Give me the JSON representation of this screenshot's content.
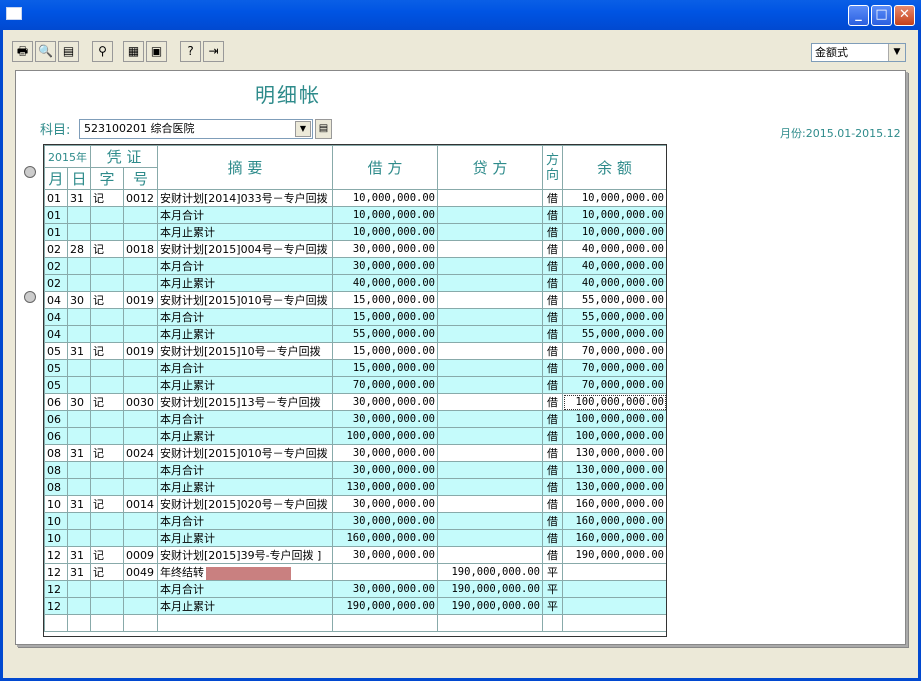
{
  "window": {
    "minimize": "_",
    "maximize": "□",
    "close": "✕"
  },
  "toolbar": {
    "buttons": [
      {
        "name": "print-icon",
        "glyph": "🖶"
      },
      {
        "name": "print-preview-icon",
        "glyph": "🔍"
      },
      {
        "name": "export-icon",
        "glyph": "▤"
      },
      {
        "name": "find-icon",
        "glyph": "⚲"
      },
      {
        "name": "grid-icon",
        "glyph": "▦"
      },
      {
        "name": "calculator-icon",
        "glyph": "▣"
      },
      {
        "name": "help-icon",
        "glyph": "?"
      },
      {
        "name": "exit-icon",
        "glyph": "⇥"
      }
    ],
    "format_select": "金额式"
  },
  "page": {
    "title": "明细帐",
    "subject_label": "科目:",
    "subject_value": "523100201   综合医院",
    "period": "月份:2015.01-2015.12"
  },
  "table": {
    "headers": {
      "year": "2015年",
      "voucher": "凭 证",
      "summary": "摘  要",
      "debit": "借  方",
      "credit": "贷  方",
      "direction": "方向",
      "balance": "余  额",
      "month": "月",
      "day": "日",
      "word": "字",
      "number": "号"
    },
    "rows": [
      {
        "m": "01",
        "d": "31",
        "w": "记",
        "n": "0012",
        "s": "安财计划[2014]033号－专户回拨",
        "debit": "10,000,000.00",
        "credit": "",
        "dir": "借",
        "bal": "10,000,000.00",
        "style": "white"
      },
      {
        "m": "01",
        "d": "",
        "w": "",
        "n": "",
        "s": "本月合计",
        "debit": "10,000,000.00",
        "credit": "",
        "dir": "借",
        "bal": "10,000,000.00",
        "style": "cyan"
      },
      {
        "m": "01",
        "d": "",
        "w": "",
        "n": "",
        "s": "本月止累计",
        "debit": "10,000,000.00",
        "credit": "",
        "dir": "借",
        "bal": "10,000,000.00",
        "style": "cyan"
      },
      {
        "m": "02",
        "d": "28",
        "w": "记",
        "n": "0018",
        "s": "安财计划[2015]004号－专户回拨",
        "debit": "30,000,000.00",
        "credit": "",
        "dir": "借",
        "bal": "40,000,000.00",
        "style": "white"
      },
      {
        "m": "02",
        "d": "",
        "w": "",
        "n": "",
        "s": "本月合计",
        "debit": "30,000,000.00",
        "credit": "",
        "dir": "借",
        "bal": "40,000,000.00",
        "style": "cyan"
      },
      {
        "m": "02",
        "d": "",
        "w": "",
        "n": "",
        "s": "本月止累计",
        "debit": "40,000,000.00",
        "credit": "",
        "dir": "借",
        "bal": "40,000,000.00",
        "style": "cyan"
      },
      {
        "m": "04",
        "d": "30",
        "w": "记",
        "n": "0019",
        "s": "安财计划[2015]010号－专户回拨",
        "debit": "15,000,000.00",
        "credit": "",
        "dir": "借",
        "bal": "55,000,000.00",
        "style": "white"
      },
      {
        "m": "04",
        "d": "",
        "w": "",
        "n": "",
        "s": "本月合计",
        "debit": "15,000,000.00",
        "credit": "",
        "dir": "借",
        "bal": "55,000,000.00",
        "style": "cyan"
      },
      {
        "m": "04",
        "d": "",
        "w": "",
        "n": "",
        "s": "本月止累计",
        "debit": "55,000,000.00",
        "credit": "",
        "dir": "借",
        "bal": "55,000,000.00",
        "style": "cyan"
      },
      {
        "m": "05",
        "d": "31",
        "w": "记",
        "n": "0019",
        "s": "安财计划[2015]10号－专户回拨",
        "debit": "15,000,000.00",
        "credit": "",
        "dir": "借",
        "bal": "70,000,000.00",
        "style": "white"
      },
      {
        "m": "05",
        "d": "",
        "w": "",
        "n": "",
        "s": "本月合计",
        "debit": "15,000,000.00",
        "credit": "",
        "dir": "借",
        "bal": "70,000,000.00",
        "style": "cyan"
      },
      {
        "m": "05",
        "d": "",
        "w": "",
        "n": "",
        "s": "本月止累计",
        "debit": "70,000,000.00",
        "credit": "",
        "dir": "借",
        "bal": "70,000,000.00",
        "style": "cyan"
      },
      {
        "m": "06",
        "d": "30",
        "w": "记",
        "n": "0030",
        "s": "安财计划[2015]13号－专户回拨",
        "debit": "30,000,000.00",
        "credit": "",
        "dir": "借",
        "bal": "100,000,000.00",
        "style": "white",
        "sel": true
      },
      {
        "m": "06",
        "d": "",
        "w": "",
        "n": "",
        "s": "本月合计",
        "debit": "30,000,000.00",
        "credit": "",
        "dir": "借",
        "bal": "100,000,000.00",
        "style": "cyan"
      },
      {
        "m": "06",
        "d": "",
        "w": "",
        "n": "",
        "s": "本月止累计",
        "debit": "100,000,000.00",
        "credit": "",
        "dir": "借",
        "bal": "100,000,000.00",
        "style": "cyan"
      },
      {
        "m": "08",
        "d": "31",
        "w": "记",
        "n": "0024",
        "s": "安财计划[2015]010号－专户回拨",
        "debit": "30,000,000.00",
        "credit": "",
        "dir": "借",
        "bal": "130,000,000.00",
        "style": "white"
      },
      {
        "m": "08",
        "d": "",
        "w": "",
        "n": "",
        "s": "本月合计",
        "debit": "30,000,000.00",
        "credit": "",
        "dir": "借",
        "bal": "130,000,000.00",
        "style": "cyan"
      },
      {
        "m": "08",
        "d": "",
        "w": "",
        "n": "",
        "s": "本月止累计",
        "debit": "130,000,000.00",
        "credit": "",
        "dir": "借",
        "bal": "130,000,000.00",
        "style": "cyan"
      },
      {
        "m": "10",
        "d": "31",
        "w": "记",
        "n": "0014",
        "s": "安财计划[2015]020号－专户回拨",
        "debit": "30,000,000.00",
        "credit": "",
        "dir": "借",
        "bal": "160,000,000.00",
        "style": "white"
      },
      {
        "m": "10",
        "d": "",
        "w": "",
        "n": "",
        "s": "本月合计",
        "debit": "30,000,000.00",
        "credit": "",
        "dir": "借",
        "bal": "160,000,000.00",
        "style": "cyan"
      },
      {
        "m": "10",
        "d": "",
        "w": "",
        "n": "",
        "s": "本月止累计",
        "debit": "160,000,000.00",
        "credit": "",
        "dir": "借",
        "bal": "160,000,000.00",
        "style": "cyan"
      },
      {
        "m": "12",
        "d": "31",
        "w": "记",
        "n": "0009",
        "s": "安财计划[2015]39号-专户回拨 ]",
        "debit": "30,000,000.00",
        "credit": "",
        "dir": "借",
        "bal": "190,000,000.00",
        "style": "white"
      },
      {
        "m": "12",
        "d": "31",
        "w": "记",
        "n": "0049",
        "s": "年终结转",
        "debit": "",
        "credit": "190,000,000.00",
        "dir": "平",
        "bal": "",
        "style": "white",
        "redact": true
      },
      {
        "m": "12",
        "d": "",
        "w": "",
        "n": "",
        "s": "本月合计",
        "debit": "30,000,000.00",
        "credit": "190,000,000.00",
        "dir": "平",
        "bal": "",
        "style": "cyan"
      },
      {
        "m": "12",
        "d": "",
        "w": "",
        "n": "",
        "s": "本月止累计",
        "debit": "190,000,000.00",
        "credit": "190,000,000.00",
        "dir": "平",
        "bal": "",
        "style": "cyan"
      },
      {
        "m": "",
        "d": "",
        "w": "",
        "n": "",
        "s": "",
        "debit": "",
        "credit": "",
        "dir": "",
        "bal": "",
        "style": "white"
      }
    ]
  }
}
